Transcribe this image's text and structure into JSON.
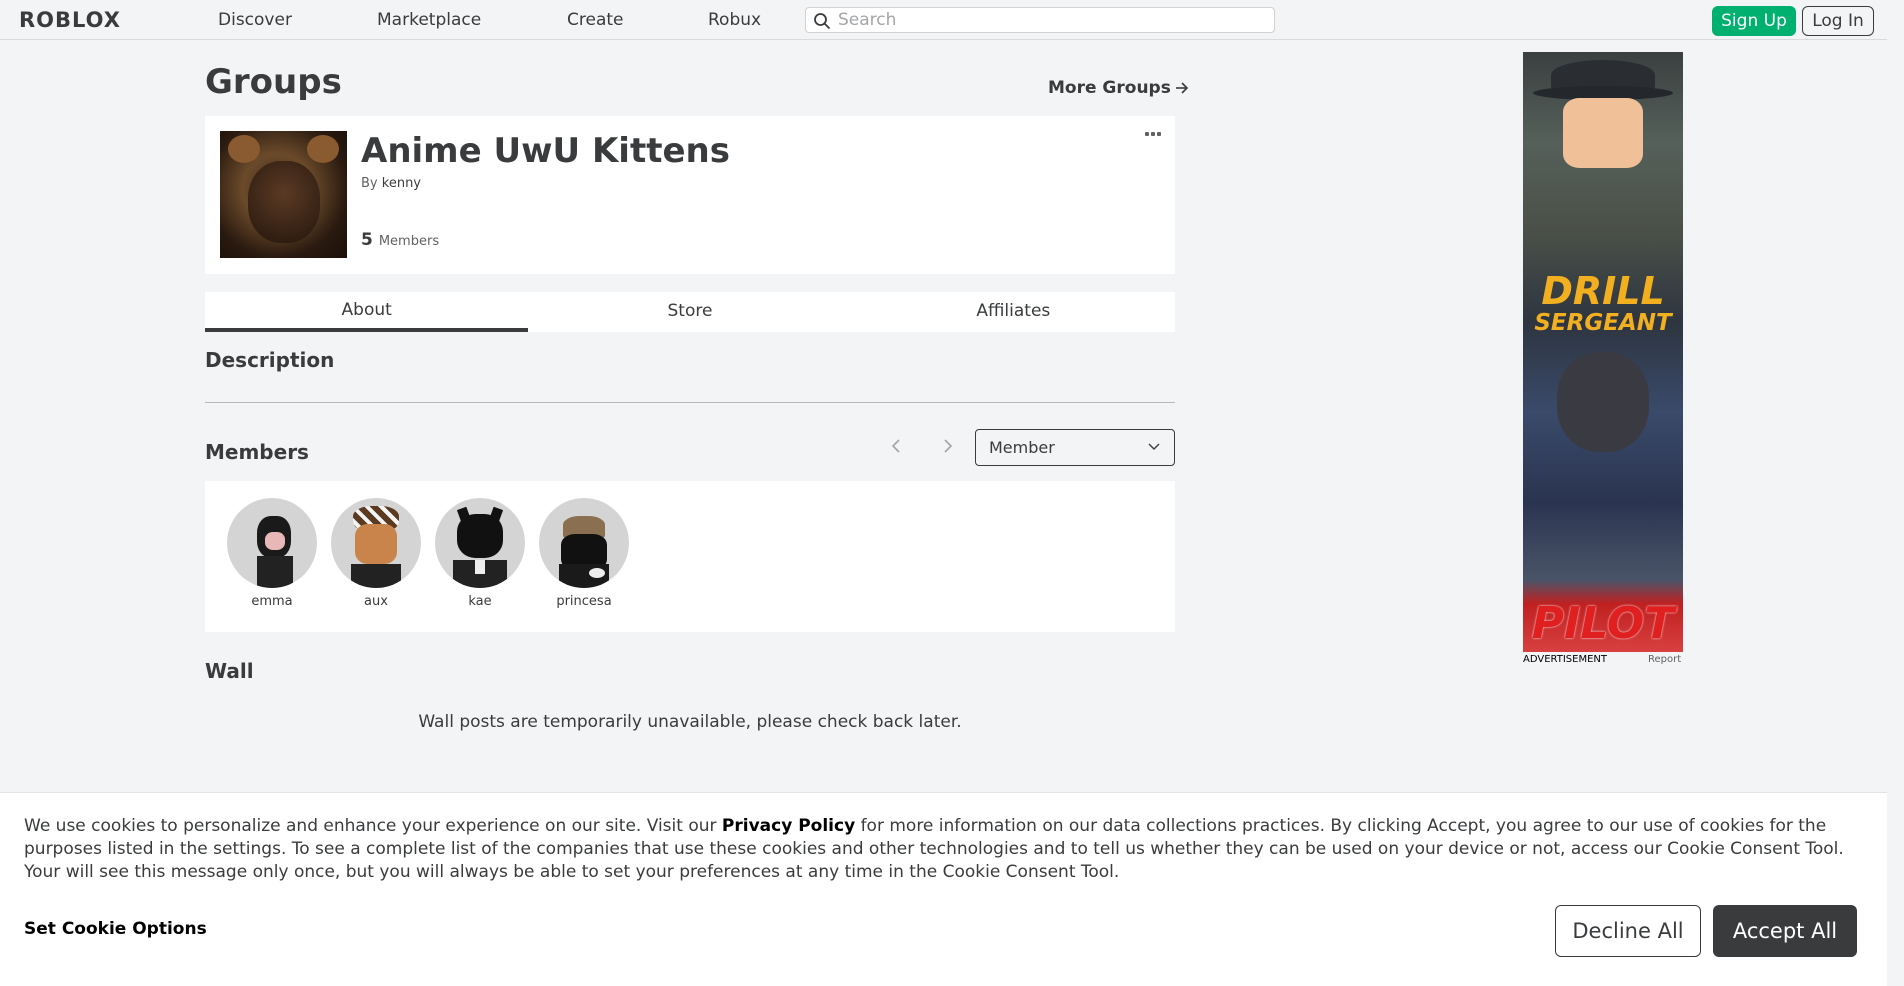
{
  "header": {
    "logo": "ROBLOX",
    "nav": [
      "Discover",
      "Marketplace",
      "Create",
      "Robux"
    ],
    "search_placeholder": "Search",
    "signup_label": "Sign Up",
    "login_label": "Log In"
  },
  "page": {
    "title": "Groups",
    "more_groups": "More Groups"
  },
  "group": {
    "name": "Anime UwU Kittens",
    "by_prefix": "By",
    "owner": "kenny",
    "member_count": "5",
    "member_label": "Members"
  },
  "tabs": [
    {
      "label": "About",
      "active": true
    },
    {
      "label": "Store",
      "active": false
    },
    {
      "label": "Affiliates",
      "active": false
    }
  ],
  "sections": {
    "description": "Description",
    "members": "Members",
    "wall": "Wall"
  },
  "members": {
    "role_selected": "Member",
    "list": [
      {
        "name": "emma"
      },
      {
        "name": "aux"
      },
      {
        "name": "kae"
      },
      {
        "name": "princesa"
      }
    ]
  },
  "wall": {
    "message": "Wall posts are temporarily unavailable, please check back later."
  },
  "ad": {
    "label": "ADVERTISEMENT",
    "report": "Report",
    "headline_1": "DRILL",
    "headline_2": "SERGEANT",
    "headline_3": "PILOT"
  },
  "cookie": {
    "text_before": "We use cookies to personalize and enhance your experience on our site. Visit our ",
    "privacy_link": "Privacy Policy",
    "text_after": " for more information on our data collections practices. By clicking Accept, you agree to our use of cookies for the purposes listed in the settings. To see a complete list of the companies that use these cookies and other technologies and to tell us whether they can be used on your device or not, access our Cookie Consent Tool. Your will see this message only once, but you will always be able to set your preferences at any time in the Cookie Consent Tool.",
    "set_options": "Set Cookie Options",
    "decline": "Decline All",
    "accept": "Accept All"
  },
  "colors": {
    "accent_green": "#00b06f",
    "text": "#393b3d",
    "background": "#f2f4f5"
  }
}
